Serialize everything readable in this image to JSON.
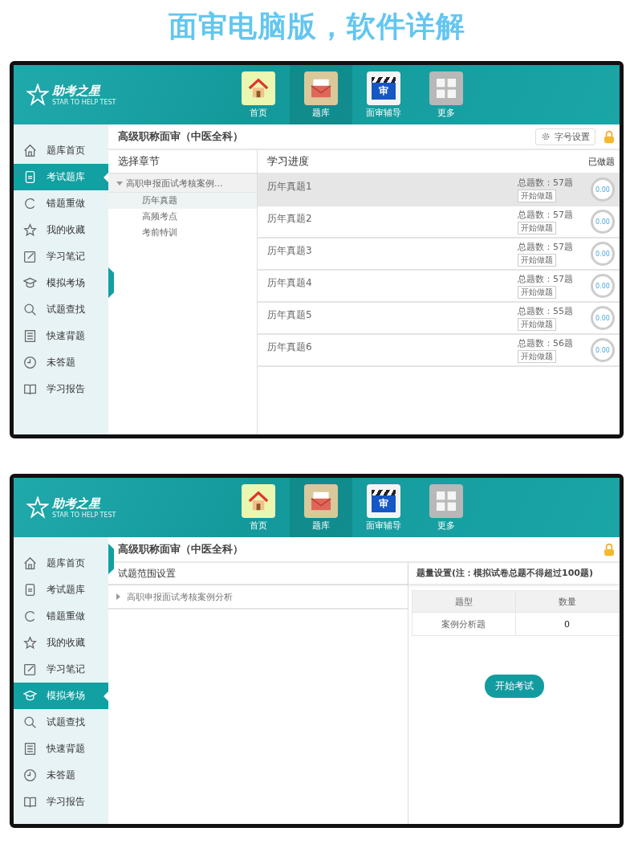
{
  "page_title": "面审电脑版，软件详解",
  "screens": [
    {
      "kind": "progress",
      "logo": {
        "name": "助考之星",
        "tagline": "STAR TO HELP TEST"
      },
      "nav": [
        {
          "label": "首页",
          "selected": false
        },
        {
          "label": "题库",
          "selected": true
        },
        {
          "label": "面审辅导",
          "icon_text": "审",
          "selected": false
        },
        {
          "label": "更多",
          "selected": false
        }
      ],
      "sidebar": [
        {
          "label": "题库首页",
          "selected": false
        },
        {
          "label": "考试题库",
          "selected": true
        },
        {
          "label": "错题重做",
          "selected": false
        },
        {
          "label": "我的收藏",
          "selected": false
        },
        {
          "label": "学习笔记",
          "selected": false
        },
        {
          "label": "模拟考场",
          "selected": false
        },
        {
          "label": "试题查找",
          "selected": false
        },
        {
          "label": "快速背题",
          "selected": false
        },
        {
          "label": "未答题",
          "selected": false
        },
        {
          "label": "学习报告",
          "selected": false
        }
      ],
      "subject": "高级职称面审（中医全科）",
      "font_button": "字号设置",
      "chapter_header": "选择章节",
      "tree": {
        "label": "高职申报面试考核案例...",
        "expanded": true,
        "children": [
          {
            "label": "历年真题",
            "selected": true
          },
          {
            "label": "高频考点",
            "selected": false
          },
          {
            "label": "考前特训",
            "selected": false
          }
        ]
      },
      "progress_header": "学习进度",
      "done_header": "已做题",
      "rows": [
        {
          "title": "历年真题1",
          "total": "总题数：57题",
          "button": "开始做题",
          "percent": "0.00",
          "selected": true
        },
        {
          "title": "历年真题2",
          "total": "总题数：57题",
          "button": "开始做题",
          "percent": "0.00",
          "selected": false
        },
        {
          "title": "历年真题3",
          "total": "总题数：57题",
          "button": "开始做题",
          "percent": "0.00",
          "selected": false
        },
        {
          "title": "历年真题4",
          "total": "总题数：57题",
          "button": "开始做题",
          "percent": "0.00",
          "selected": false
        },
        {
          "title": "历年真题5",
          "total": "总题数：55题",
          "button": "开始做题",
          "percent": "0.00",
          "selected": false
        },
        {
          "title": "历年真题6",
          "total": "总题数：56题",
          "button": "开始做题",
          "percent": "0.00",
          "selected": false
        }
      ]
    },
    {
      "kind": "exam",
      "logo": {
        "name": "助考之星",
        "tagline": "STAR TO HELP TEST"
      },
      "nav": [
        {
          "label": "首页",
          "selected": false
        },
        {
          "label": "题库",
          "selected": true
        },
        {
          "label": "面审辅导",
          "icon_text": "审",
          "selected": false
        },
        {
          "label": "更多",
          "selected": false
        }
      ],
      "sidebar": [
        {
          "label": "题库首页",
          "selected": false
        },
        {
          "label": "考试题库",
          "selected": false
        },
        {
          "label": "错题重做",
          "selected": false
        },
        {
          "label": "我的收藏",
          "selected": false
        },
        {
          "label": "学习笔记",
          "selected": false
        },
        {
          "label": "模拟考场",
          "selected": true
        },
        {
          "label": "试题查找",
          "selected": false
        },
        {
          "label": "快速背题",
          "selected": false
        },
        {
          "label": "未答题",
          "selected": false
        },
        {
          "label": "学习报告",
          "selected": false
        }
      ],
      "subject": "高级职称面审（中医全科）",
      "range_header": "试题范围设置",
      "tree": {
        "label": "高职申报面试考核案例分析",
        "expanded": false
      },
      "quantity_header": "题量设置(注：模拟试卷总题不得超过100题)",
      "table": {
        "columns": [
          "题型",
          "数量"
        ],
        "rows": [
          [
            "案例分析题",
            "0"
          ]
        ]
      },
      "start_button": "开始考试"
    }
  ]
}
